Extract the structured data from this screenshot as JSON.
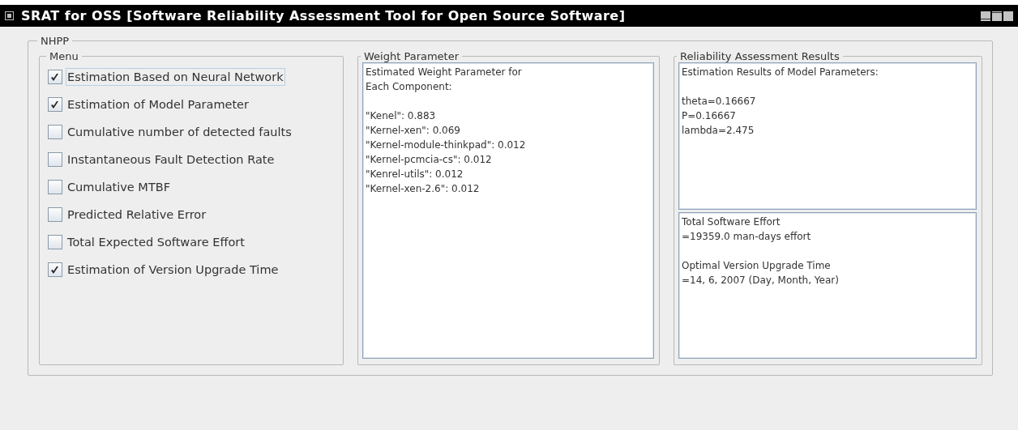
{
  "window": {
    "title": "SRAT for OSS [Software Reliability Assessment Tool for Open Source Software]"
  },
  "group": {
    "title": "NHPP"
  },
  "menu": {
    "title": "Menu",
    "items": [
      {
        "label": "Estimation Based on Neural Network",
        "checked": true,
        "focused": true
      },
      {
        "label": "Estimation of Model Parameter",
        "checked": true,
        "focused": false
      },
      {
        "label": "Cumulative number of detected faults",
        "checked": false,
        "focused": false
      },
      {
        "label": "Instantaneous Fault Detection Rate",
        "checked": false,
        "focused": false
      },
      {
        "label": "Cumulative MTBF",
        "checked": false,
        "focused": false
      },
      {
        "label": "Predicted Relative Error",
        "checked": false,
        "focused": false
      },
      {
        "label": "Total Expected Software Effort",
        "checked": false,
        "focused": false
      },
      {
        "label": "Estimation of Version Upgrade Time",
        "checked": true,
        "focused": false
      }
    ]
  },
  "weight_parameter": {
    "title": "Weight Parameter",
    "text_areas": [
      {
        "paragraphs": [
          [
            "Estimated Weight Parameter for",
            "Each Component:"
          ],
          [
            "\"Kenel\": 0.883",
            "\"Kernel-xen\": 0.069",
            "\"Kernel-module-thinkpad\": 0.012",
            "\"Kernel-pcmcia-cs\": 0.012",
            "\"Kenrel-utils\": 0.012",
            "\"Kernel-xen-2.6\": 0.012"
          ]
        ]
      }
    ]
  },
  "results": {
    "title": "Reliability Assessment Results",
    "text_areas": [
      {
        "paragraphs": [
          [
            "Estimation Results of Model Parameters:"
          ],
          [
            "theta=0.16667",
            "P=0.16667",
            "lambda=2.475"
          ]
        ]
      },
      {
        "paragraphs": [
          [
            "Total Software Effort",
            "=19359.0 man-days effort"
          ],
          [
            "Optimal Version Upgrade Time",
            "=14, 6, 2007 (Day, Month, Year)"
          ]
        ]
      }
    ]
  }
}
